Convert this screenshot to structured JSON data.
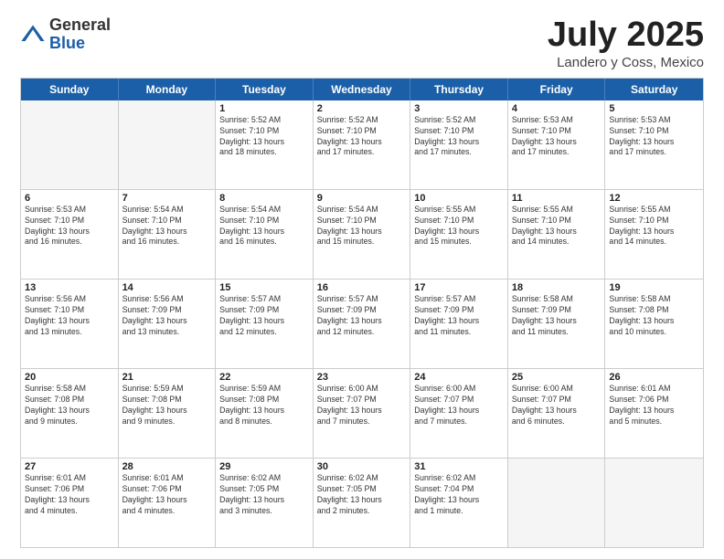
{
  "logo": {
    "general": "General",
    "blue": "Blue"
  },
  "title": "July 2025",
  "location": "Landero y Coss, Mexico",
  "weekdays": [
    "Sunday",
    "Monday",
    "Tuesday",
    "Wednesday",
    "Thursday",
    "Friday",
    "Saturday"
  ],
  "weeks": [
    [
      {
        "day": "",
        "info": ""
      },
      {
        "day": "",
        "info": ""
      },
      {
        "day": "1",
        "info": "Sunrise: 5:52 AM\nSunset: 7:10 PM\nDaylight: 13 hours\nand 18 minutes."
      },
      {
        "day": "2",
        "info": "Sunrise: 5:52 AM\nSunset: 7:10 PM\nDaylight: 13 hours\nand 17 minutes."
      },
      {
        "day": "3",
        "info": "Sunrise: 5:52 AM\nSunset: 7:10 PM\nDaylight: 13 hours\nand 17 minutes."
      },
      {
        "day": "4",
        "info": "Sunrise: 5:53 AM\nSunset: 7:10 PM\nDaylight: 13 hours\nand 17 minutes."
      },
      {
        "day": "5",
        "info": "Sunrise: 5:53 AM\nSunset: 7:10 PM\nDaylight: 13 hours\nand 17 minutes."
      }
    ],
    [
      {
        "day": "6",
        "info": "Sunrise: 5:53 AM\nSunset: 7:10 PM\nDaylight: 13 hours\nand 16 minutes."
      },
      {
        "day": "7",
        "info": "Sunrise: 5:54 AM\nSunset: 7:10 PM\nDaylight: 13 hours\nand 16 minutes."
      },
      {
        "day": "8",
        "info": "Sunrise: 5:54 AM\nSunset: 7:10 PM\nDaylight: 13 hours\nand 16 minutes."
      },
      {
        "day": "9",
        "info": "Sunrise: 5:54 AM\nSunset: 7:10 PM\nDaylight: 13 hours\nand 15 minutes."
      },
      {
        "day": "10",
        "info": "Sunrise: 5:55 AM\nSunset: 7:10 PM\nDaylight: 13 hours\nand 15 minutes."
      },
      {
        "day": "11",
        "info": "Sunrise: 5:55 AM\nSunset: 7:10 PM\nDaylight: 13 hours\nand 14 minutes."
      },
      {
        "day": "12",
        "info": "Sunrise: 5:55 AM\nSunset: 7:10 PM\nDaylight: 13 hours\nand 14 minutes."
      }
    ],
    [
      {
        "day": "13",
        "info": "Sunrise: 5:56 AM\nSunset: 7:10 PM\nDaylight: 13 hours\nand 13 minutes."
      },
      {
        "day": "14",
        "info": "Sunrise: 5:56 AM\nSunset: 7:09 PM\nDaylight: 13 hours\nand 13 minutes."
      },
      {
        "day": "15",
        "info": "Sunrise: 5:57 AM\nSunset: 7:09 PM\nDaylight: 13 hours\nand 12 minutes."
      },
      {
        "day": "16",
        "info": "Sunrise: 5:57 AM\nSunset: 7:09 PM\nDaylight: 13 hours\nand 12 minutes."
      },
      {
        "day": "17",
        "info": "Sunrise: 5:57 AM\nSunset: 7:09 PM\nDaylight: 13 hours\nand 11 minutes."
      },
      {
        "day": "18",
        "info": "Sunrise: 5:58 AM\nSunset: 7:09 PM\nDaylight: 13 hours\nand 11 minutes."
      },
      {
        "day": "19",
        "info": "Sunrise: 5:58 AM\nSunset: 7:08 PM\nDaylight: 13 hours\nand 10 minutes."
      }
    ],
    [
      {
        "day": "20",
        "info": "Sunrise: 5:58 AM\nSunset: 7:08 PM\nDaylight: 13 hours\nand 9 minutes."
      },
      {
        "day": "21",
        "info": "Sunrise: 5:59 AM\nSunset: 7:08 PM\nDaylight: 13 hours\nand 9 minutes."
      },
      {
        "day": "22",
        "info": "Sunrise: 5:59 AM\nSunset: 7:08 PM\nDaylight: 13 hours\nand 8 minutes."
      },
      {
        "day": "23",
        "info": "Sunrise: 6:00 AM\nSunset: 7:07 PM\nDaylight: 13 hours\nand 7 minutes."
      },
      {
        "day": "24",
        "info": "Sunrise: 6:00 AM\nSunset: 7:07 PM\nDaylight: 13 hours\nand 7 minutes."
      },
      {
        "day": "25",
        "info": "Sunrise: 6:00 AM\nSunset: 7:07 PM\nDaylight: 13 hours\nand 6 minutes."
      },
      {
        "day": "26",
        "info": "Sunrise: 6:01 AM\nSunset: 7:06 PM\nDaylight: 13 hours\nand 5 minutes."
      }
    ],
    [
      {
        "day": "27",
        "info": "Sunrise: 6:01 AM\nSunset: 7:06 PM\nDaylight: 13 hours\nand 4 minutes."
      },
      {
        "day": "28",
        "info": "Sunrise: 6:01 AM\nSunset: 7:06 PM\nDaylight: 13 hours\nand 4 minutes."
      },
      {
        "day": "29",
        "info": "Sunrise: 6:02 AM\nSunset: 7:05 PM\nDaylight: 13 hours\nand 3 minutes."
      },
      {
        "day": "30",
        "info": "Sunrise: 6:02 AM\nSunset: 7:05 PM\nDaylight: 13 hours\nand 2 minutes."
      },
      {
        "day": "31",
        "info": "Sunrise: 6:02 AM\nSunset: 7:04 PM\nDaylight: 13 hours\nand 1 minute."
      },
      {
        "day": "",
        "info": ""
      },
      {
        "day": "",
        "info": ""
      }
    ]
  ]
}
